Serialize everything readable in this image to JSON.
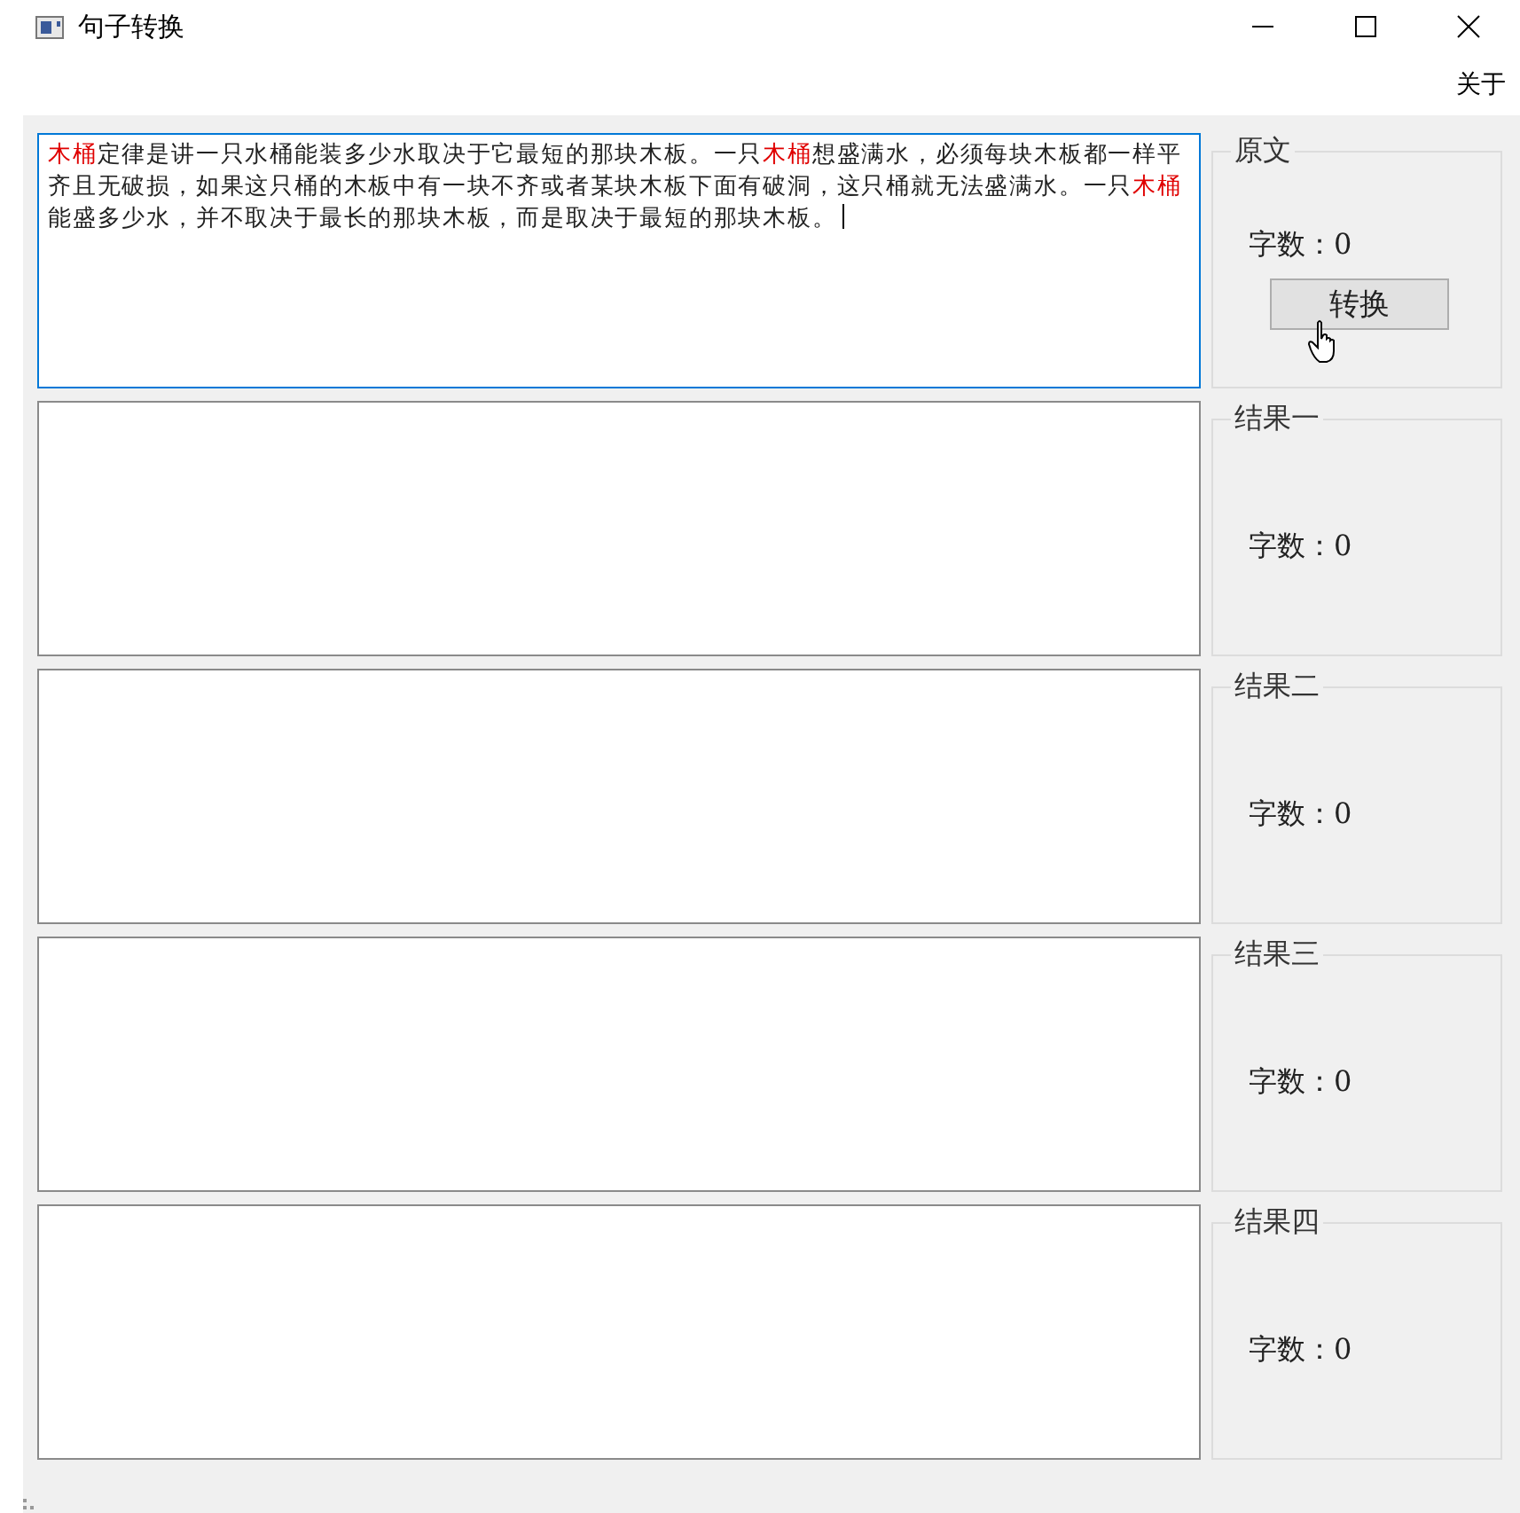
{
  "window": {
    "title": "句子转换"
  },
  "menu": [
    {
      "label": "关于"
    }
  ],
  "sections": [
    {
      "legend": "原文",
      "count_label": "字数：0",
      "focused": true,
      "button": "转换",
      "text": [
        {
          "text": "木桶",
          "highlight": true
        },
        {
          "text": "定律是讲一只水桶能装多少水取决于它最短的那块木板。一只",
          "highlight": false
        },
        {
          "text": "木桶",
          "highlight": true
        },
        {
          "text": "想盛满水，必须每块木板都一样平齐且无破损，如果这只桶的木板中有一块不齐或者某块木板下面有破洞，这只桶就无法盛满水。一只",
          "highlight": false
        },
        {
          "text": "木桶",
          "highlight": true
        },
        {
          "text": "能盛多少水，并不取决于最长的那块木板，而是取决于最短的那块木板。",
          "highlight": false
        }
      ]
    },
    {
      "legend": "结果一",
      "count_label": "字数：0",
      "focused": false
    },
    {
      "legend": "结果二",
      "count_label": "字数：0",
      "focused": false
    },
    {
      "legend": "结果三",
      "count_label": "字数：0",
      "focused": false
    },
    {
      "legend": "结果四",
      "count_label": "字数：0",
      "focused": false
    }
  ]
}
